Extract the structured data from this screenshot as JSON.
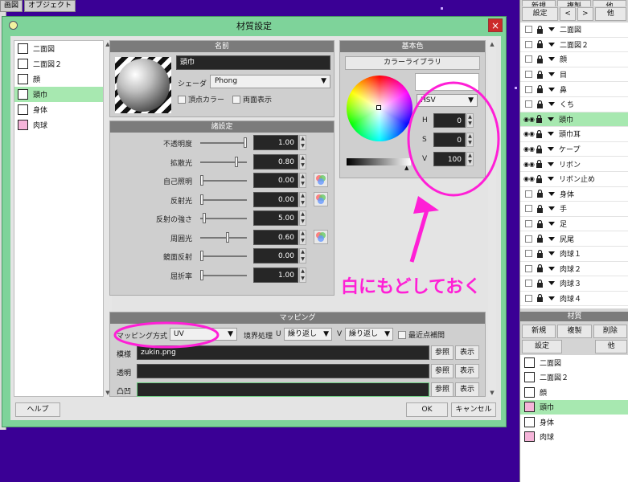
{
  "topmenu": [
    "画図",
    "オブジェクト"
  ],
  "dialog": {
    "title": "材質設定",
    "close": "×",
    "materials": [
      {
        "name": "二面図",
        "color": "#ffffff"
      },
      {
        "name": "二面図２",
        "color": "#ffffff"
      },
      {
        "name": "顔",
        "color": "#ffffff"
      },
      {
        "name": "頭巾",
        "color": "#ffffff",
        "selected": true
      },
      {
        "name": "身体",
        "color": "#ffffff"
      },
      {
        "name": "肉球",
        "color": "#f5b4d9"
      }
    ],
    "name_panel": {
      "header": "名前",
      "name_value": "頭巾",
      "shader_label": "シェーダ",
      "shader_value": "Phong",
      "vertex_color_label": "頂点カラー",
      "double_sided_label": "両面表示"
    },
    "settings_panel": {
      "header": "諸設定",
      "rows": [
        {
          "label": "不透明度",
          "value": "1.00",
          "level": 1.0,
          "rgb": false
        },
        {
          "label": "拡散光",
          "value": "0.80",
          "level": 0.8,
          "rgb": false
        },
        {
          "label": "自己照明",
          "value": "0.00",
          "level": 0.0,
          "rgb": true
        },
        {
          "label": "反射光",
          "value": "0.00",
          "level": 0.0,
          "rgb": true
        },
        {
          "label": "反射の強さ",
          "value": "5.00",
          "level": 0.05,
          "rgb": false
        },
        {
          "label": "周囲光",
          "value": "0.60",
          "level": 0.6,
          "rgb": true
        },
        {
          "label": "鏡面反射",
          "value": "0.00",
          "level": 0.0,
          "rgb": false
        },
        {
          "label": "屈折率",
          "value": "1.00",
          "level": 0.0,
          "rgb": false
        }
      ]
    },
    "color_panel": {
      "header": "基本色",
      "library_button": "カラーライブラリ",
      "mode": "HSV",
      "h_label": "H",
      "h_value": "0",
      "s_label": "S",
      "s_value": "0",
      "v_label": "V",
      "v_value": "100"
    },
    "mapping_panel": {
      "header": "マッピング",
      "method_label": "マッピング方式",
      "method_value": "UV",
      "border_label": "境界処理",
      "u_label": "U",
      "u_value": "繰り返し",
      "v_label": "V",
      "v_value": "繰り返し",
      "nearest_label": "最近点補間",
      "rows": [
        {
          "label": "模様",
          "value": "zukin.png",
          "browse": "参照",
          "show": "表示"
        },
        {
          "label": "透明",
          "value": "",
          "browse": "参照",
          "show": "表示"
        },
        {
          "label": "凸凹",
          "value": "",
          "browse": "参照",
          "show": "表示"
        }
      ]
    },
    "help_button": "ヘルプ",
    "ok_button": "OK",
    "cancel_button": "キャンセル"
  },
  "annotation": "白にもどしておく",
  "annotation_color": "#ff1fd6",
  "right_panel": {
    "top_buttons": [
      "新規",
      "複製",
      "他"
    ],
    "settings_button": "設定",
    "prev": "<",
    "next": ">",
    "objects": [
      {
        "name": "二面図",
        "eye": false
      },
      {
        "name": "二面図２",
        "eye": false
      },
      {
        "name": "顔",
        "eye": false
      },
      {
        "name": "目",
        "eye": false
      },
      {
        "name": "鼻",
        "eye": false
      },
      {
        "name": "くち",
        "eye": false
      },
      {
        "name": "頭巾",
        "eye": true,
        "selected": true
      },
      {
        "name": "頭巾耳",
        "eye": true
      },
      {
        "name": "ケープ",
        "eye": true
      },
      {
        "name": "リボン",
        "eye": true
      },
      {
        "name": "リボン止め",
        "eye": true
      },
      {
        "name": "身体",
        "eye": false
      },
      {
        "name": "手",
        "eye": false
      },
      {
        "name": "足",
        "eye": false
      },
      {
        "name": "尻尾",
        "eye": false
      },
      {
        "name": "肉球１",
        "eye": false
      },
      {
        "name": "肉球２",
        "eye": false
      },
      {
        "name": "肉球３",
        "eye": false
      },
      {
        "name": "肉球４",
        "eye": false
      }
    ],
    "material_header": "材質",
    "mat_buttons": [
      "新規",
      "複製",
      "削除"
    ],
    "mat_settings": "設定",
    "mat_other": "他",
    "materials": [
      {
        "name": "二面図",
        "color": "#ffffff"
      },
      {
        "name": "二面図２",
        "color": "#ffffff"
      },
      {
        "name": "顔",
        "color": "#ffffff"
      },
      {
        "name": "頭巾",
        "color": "#f5b4d9",
        "selected": true
      },
      {
        "name": "身体",
        "color": "#ffffff"
      },
      {
        "name": "肉球",
        "color": "#f5b4d9"
      }
    ]
  }
}
